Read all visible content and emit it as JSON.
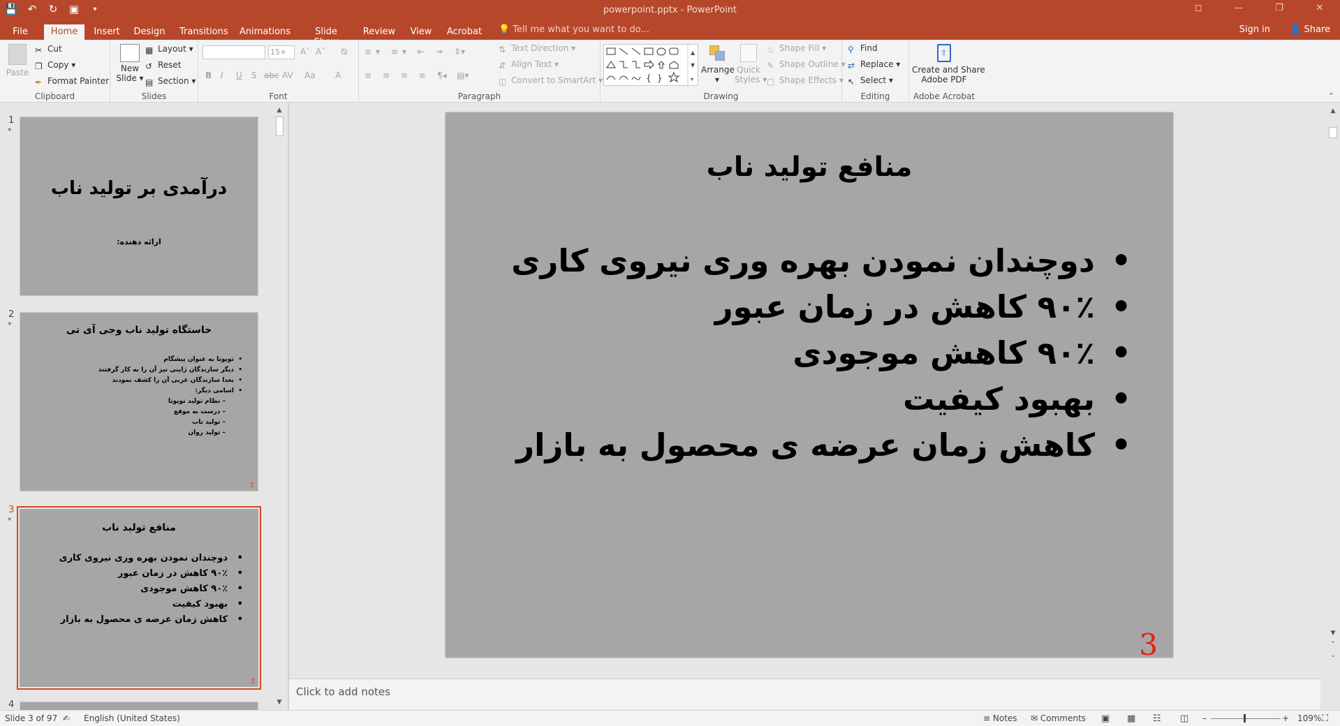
{
  "window": {
    "title": "powerpoint.pptx - PowerPoint"
  },
  "qat": {
    "save_icon": "save-icon",
    "undo_icon": "undo-icon",
    "redo_icon": "redo-icon",
    "present_icon": "present-icon"
  },
  "tabs": [
    {
      "label": "File"
    },
    {
      "label": "Home"
    },
    {
      "label": "Insert"
    },
    {
      "label": "Design"
    },
    {
      "label": "Transitions"
    },
    {
      "label": "Animations"
    },
    {
      "label": "Slide Show"
    },
    {
      "label": "Review"
    },
    {
      "label": "View"
    },
    {
      "label": "Acrobat"
    }
  ],
  "tellme": "Tell me what you want to do...",
  "account": {
    "signin": "Sign in",
    "share": "Share"
  },
  "ribbon": {
    "clipboard": {
      "paste": "Paste",
      "cut": "Cut",
      "copy": "Copy",
      "format_painter": "Format Painter",
      "label": "Clipboard"
    },
    "slides": {
      "new_slide_1": "New",
      "new_slide_2": "Slide",
      "layout": "Layout",
      "reset": "Reset",
      "section": "Section",
      "label": "Slides"
    },
    "font": {
      "size": "15+",
      "label": "Font",
      "bold": "B",
      "italic": "I",
      "underline": "U",
      "shadow": "S",
      "strike": "abc",
      "spacing": "AV",
      "case": "Aa",
      "color": "A"
    },
    "paragraph": {
      "text_direction": "Text Direction",
      "align_text": "Align Text",
      "smartart": "Convert to SmartArt",
      "label": "Paragraph"
    },
    "drawing": {
      "arrange": "Arrange",
      "quick_1": "Quick",
      "quick_2": "Styles",
      "shape_fill": "Shape Fill",
      "shape_outline": "Shape Outline",
      "shape_effects": "Shape Effects",
      "label": "Drawing"
    },
    "editing": {
      "find": "Find",
      "replace": "Replace",
      "select": "Select",
      "label": "Editing"
    },
    "acrobat": {
      "create_1": "Create and Share",
      "create_2": "Adobe PDF",
      "label": "Adobe Acrobat"
    }
  },
  "thumbnails": {
    "s1": {
      "num": "1",
      "star": "*",
      "title": "درآمدی بر تولید ناب",
      "subtitle": "ارائه دهنده:"
    },
    "s2": {
      "num": "2",
      "star": "*",
      "title": "خاستگاه تولید ناب وجی آی تی",
      "items": [
        "تویوتا به عنوان پیشگام",
        "دیگر سازندگان ژاپنی نیز آن را به کار گرفتند",
        "بعدا سازندگان غربی آن را کشف نمودند",
        "اسامی دیگر:",
        "–   نظام تولید تویوتا",
        "–   درست به موقع",
        "–   تولید ناب",
        "–   تولید روان"
      ],
      "slide_no": "2"
    },
    "s3": {
      "num": "3",
      "star": "*",
      "title": "منافع تولید ناب",
      "items": [
        "دوچندان نمودن بهره وری نیروی کاری",
        "۹۰٪ کاهش در زمان عبور",
        "۹۰٪ کاهش موجودی",
        "بهبود کیفیت",
        "کاهش زمان عرضه ی محصول به بازار"
      ],
      "slide_no": "3"
    },
    "s4": {
      "num": "4"
    }
  },
  "slide": {
    "title": "منافع تولید ناب",
    "bullets": [
      "دوچندان نمودن بهره وری نیروی کاری",
      "۹۰٪ کاهش در زمان عبور",
      "۹۰٪ کاهش موجودی",
      "بهبود کیفیت",
      "کاهش زمان عرضه ی محصول به بازار"
    ],
    "number": "3"
  },
  "notes": {
    "placeholder": "Click to add notes"
  },
  "status": {
    "slide_of": "Slide 3 of 97",
    "language": "English (United States)",
    "notes": "Notes",
    "comments": "Comments",
    "zoom": "109%"
  },
  "colors": {
    "accent": "#b7472a",
    "slide_bg": "#a6a6a6",
    "slide_number": "#e8200c"
  }
}
